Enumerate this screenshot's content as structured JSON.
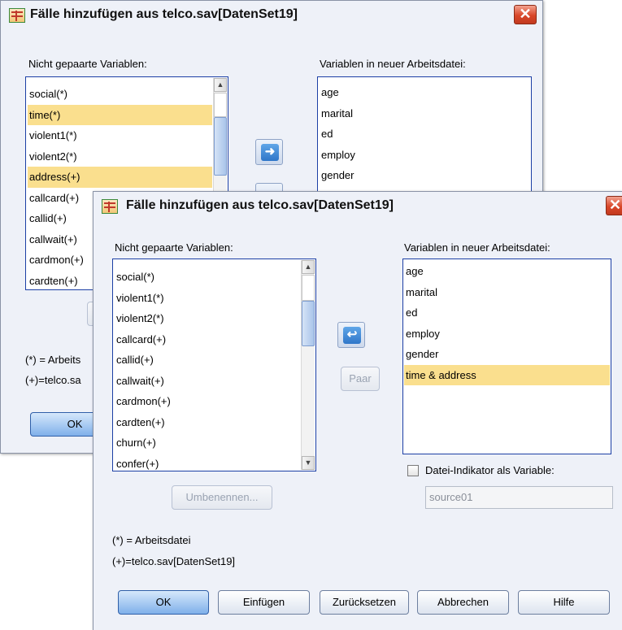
{
  "back_dialog": {
    "title": "Fälle hinzufügen aus telco.sav[DatenSet19]",
    "close_glyph": "✕",
    "unpaired_label": "Nicht gepaarte Variablen:",
    "unpaired_items": [
      "social(*)",
      "time(*)",
      "violent1(*)",
      "violent2(*)",
      "address(+)",
      "callcard(+)",
      "callid(+)",
      "callwait(+)",
      "cardmon(+)",
      "cardten(+)"
    ],
    "new_label": "Variablen in neuer Arbeitsdatei:",
    "new_items": [
      "age",
      "marital",
      "ed",
      "employ",
      "gender"
    ],
    "legend_1": "(*) = Arbeits",
    "legend_2": "(+)=telco.sa",
    "ok_label": "OK"
  },
  "front_dialog": {
    "title": "Fälle hinzufügen aus telco.sav[DatenSet19]",
    "close_glyph": "✕",
    "unpaired_label": "Nicht gepaarte Variablen:",
    "unpaired_items": [
      "social(*)",
      "violent1(*)",
      "violent2(*)",
      "callcard(+)",
      "callid(+)",
      "callwait(+)",
      "cardmon(+)",
      "cardten(+)",
      "churn(+)",
      "confer(+)"
    ],
    "new_label": "Variablen in neuer Arbeitsdatei:",
    "new_items": [
      "age",
      "marital",
      "ed",
      "employ",
      "gender",
      "time & address"
    ],
    "pair_label": "Paar",
    "rename_label": "Umbenennen...",
    "indicator_label": "Datei-Indikator als Variable:",
    "indicator_value": "source01",
    "legend_1": "(*) = Arbeitsdatei",
    "legend_2": "(+)=telco.sav[DatenSet19]",
    "buttons": {
      "ok": "OK",
      "paste": "Einfügen",
      "reset": "Zurücksetzen",
      "cancel": "Abbrechen",
      "help": "Hilfe"
    }
  },
  "icons": {
    "move_right": "➜",
    "move_left": "↩"
  },
  "colors": {
    "selection": "#fadf8e",
    "dialog_bg": "#eef1f8",
    "list_border": "#1c3fa5"
  }
}
